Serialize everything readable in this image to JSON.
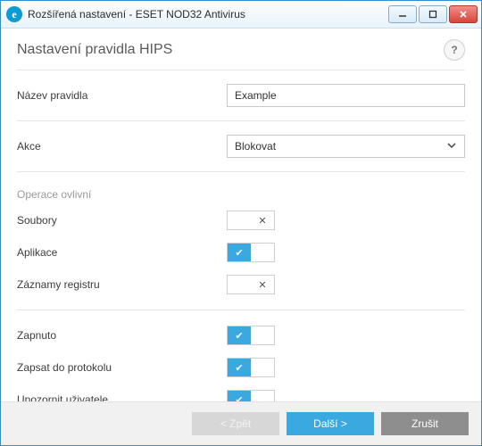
{
  "window": {
    "title": "Rozšířená nastavení - ESET NOD32 Antivirus",
    "app_icon_letter": "e"
  },
  "page": {
    "title": "Nastavení pravidla HIPS",
    "help_symbol": "?"
  },
  "fields": {
    "rule_name": {
      "label": "Název pravidla",
      "value": "Example"
    },
    "action": {
      "label": "Akce",
      "selected": "Blokovat"
    }
  },
  "section_operations_label": "Operace ovlivní",
  "toggles": {
    "files": {
      "label": "Soubory",
      "on": false
    },
    "apps": {
      "label": "Aplikace",
      "on": true
    },
    "registry": {
      "label": "Záznamy registru",
      "on": false
    },
    "enabled": {
      "label": "Zapnuto",
      "on": true
    },
    "log": {
      "label": "Zapsat do protokolu",
      "on": true
    },
    "notify": {
      "label": "Upozornit uživatele",
      "on": true
    }
  },
  "footer": {
    "back": "< Zpět",
    "next": "Další >",
    "cancel": "Zrušit"
  }
}
